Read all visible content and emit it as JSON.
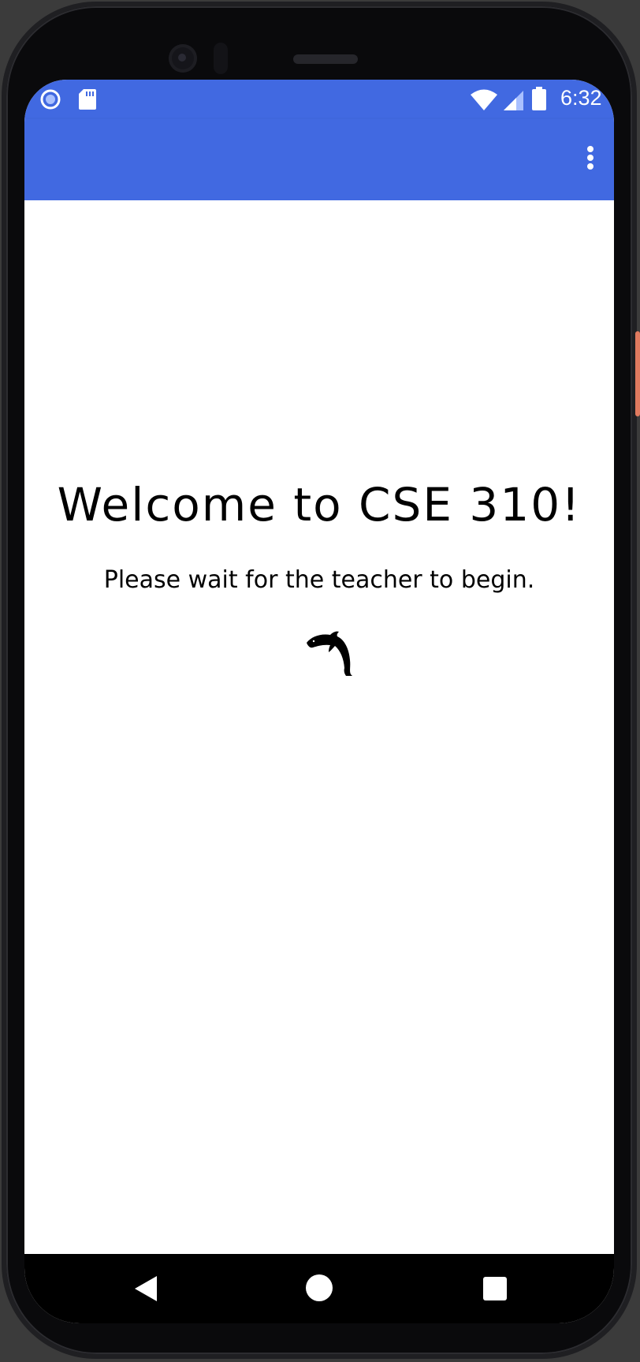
{
  "colors": {
    "app_bar": "#4169e1",
    "screen_background": "#ffffff",
    "nav_bar": "#000000"
  },
  "status_bar": {
    "time": "6:32",
    "icons": [
      "record-icon",
      "sd-card-icon",
      "wifi-icon",
      "signal-icon",
      "battery-icon"
    ]
  },
  "app_bar": {
    "menu_icon": "more-vert-icon"
  },
  "main": {
    "title": "Welcome to CSE 310!",
    "subtitle": "Please wait for the teacher to begin.",
    "image_icon": "dolphin-icon"
  },
  "nav_bar": {
    "icons": [
      "back-icon",
      "home-icon",
      "recents-icon"
    ]
  }
}
